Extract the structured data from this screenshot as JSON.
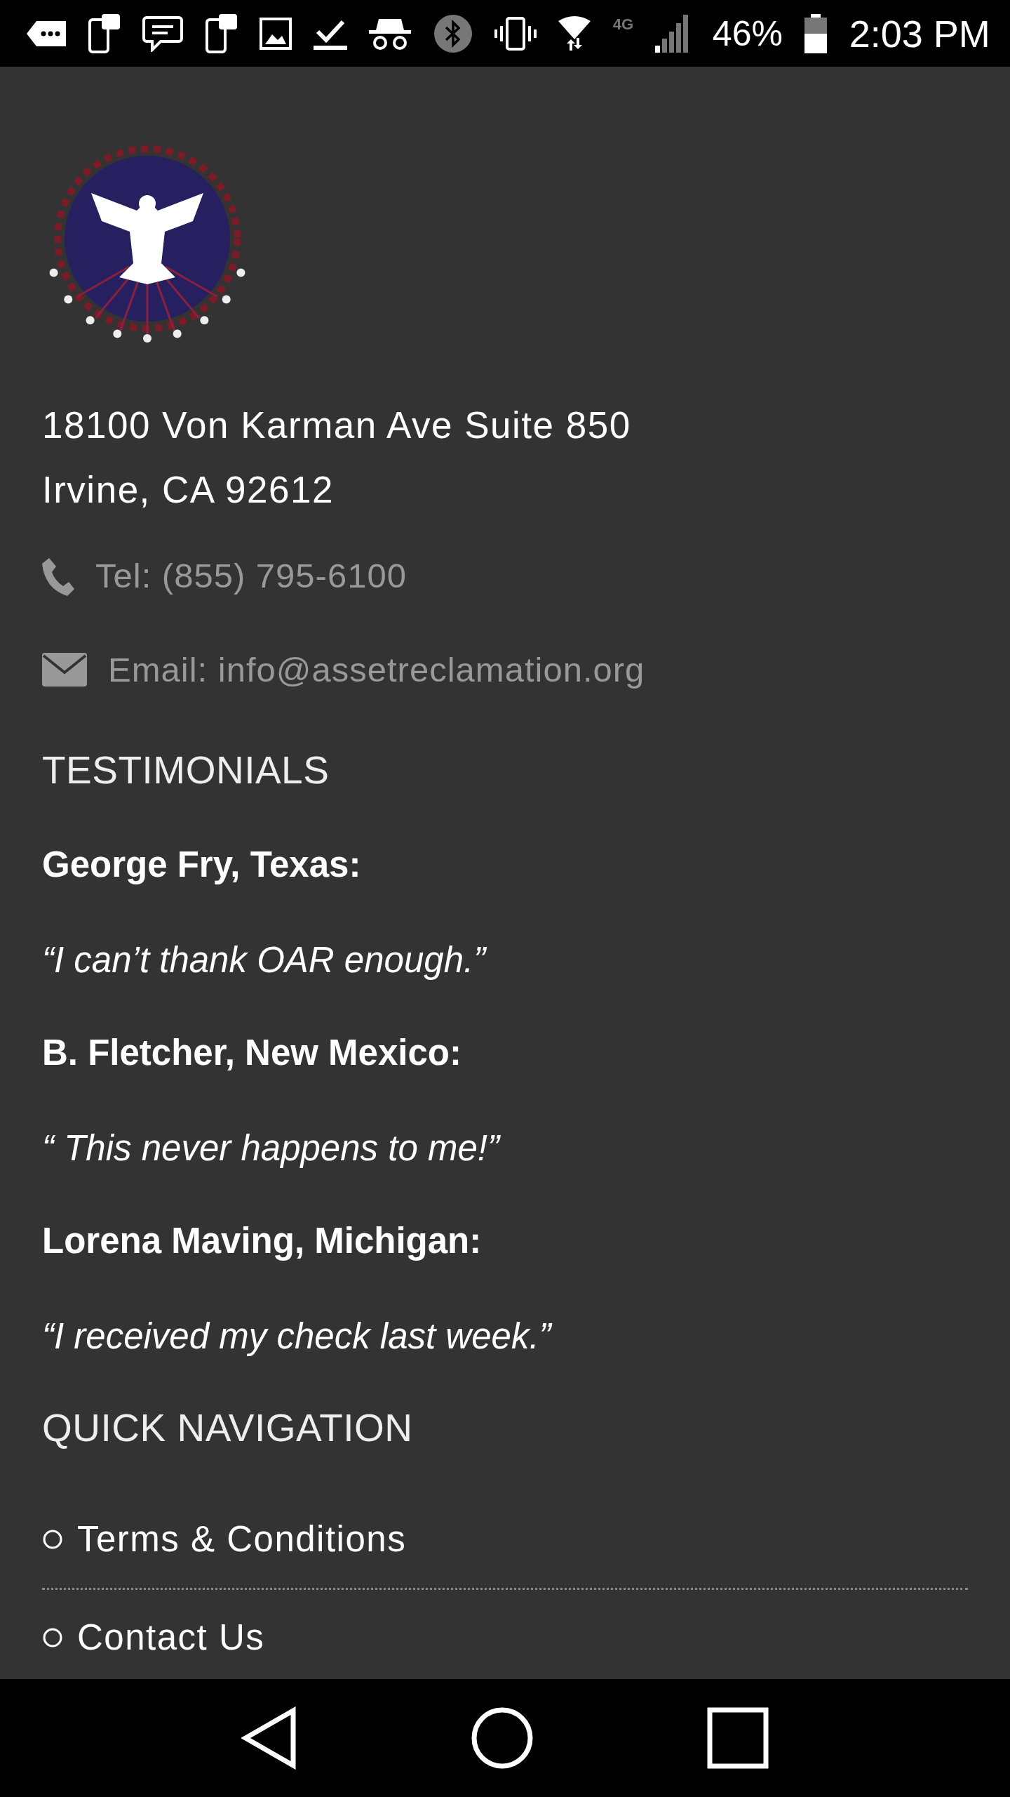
{
  "status_bar": {
    "network": "4G",
    "battery": "46%",
    "time": "2:03 PM"
  },
  "address": [
    "18100 Von Karman Ave Suite 850",
    "Irvine, CA 92612"
  ],
  "contacts": [
    {
      "kind": "phone",
      "text": "Tel: (855) 795-6100"
    },
    {
      "kind": "email",
      "text": "Email: info@assetreclamation.org"
    }
  ],
  "testimonials": {
    "title": "TESTIMONIALS",
    "items": [
      {
        "author": "George Fry, Texas:",
        "quote": "“I can’t thank OAR enough.”"
      },
      {
        "author": "B. Fletcher, New Mexico:",
        "quote": "“ This never happens to me!”"
      },
      {
        "author": "Lorena Maving, Michigan:",
        "quote": "“I received my check last week.”"
      }
    ]
  },
  "quick_navigation": {
    "title": "QUICK NAVIGATION",
    "links": [
      "Terms & Conditions",
      "Contact Us"
    ]
  }
}
